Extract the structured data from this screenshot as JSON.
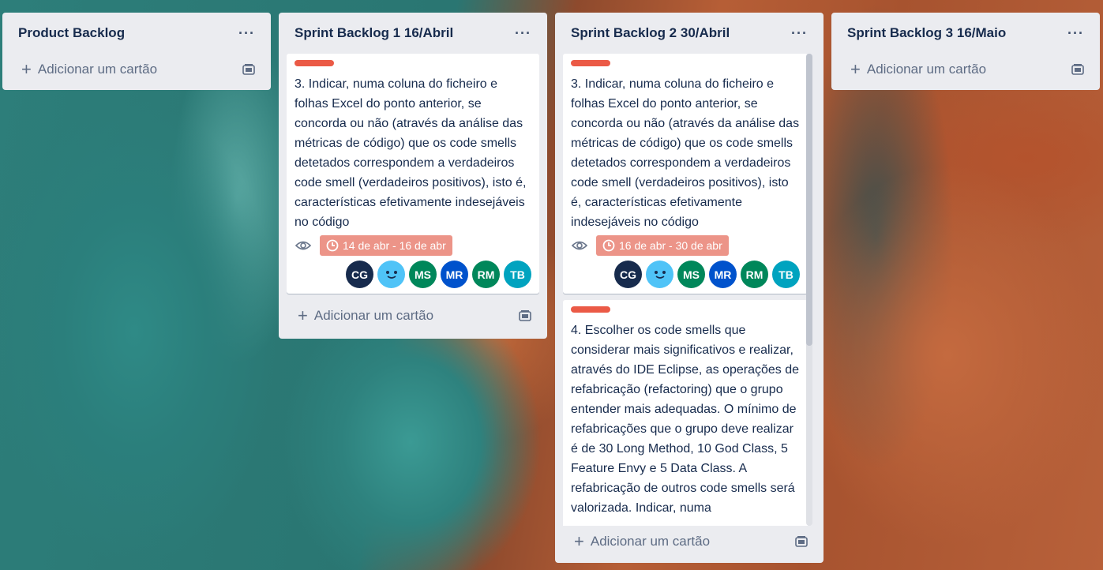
{
  "lists": [
    {
      "title": "Product Backlog",
      "add_label": "Adicionar um cartão"
    },
    {
      "title": "Sprint Backlog 1 16/Abril",
      "add_label": "Adicionar um cartão",
      "cards": [
        {
          "label_color": "#eb5a46",
          "text": "3. Indicar, numa coluna do ficheiro e folhas Excel do ponto anterior, se concorda ou não (através da análise das métricas de código) que os code smells detetados correspondem a verdadeiros code smell (verdadeiros positivos), isto é, características efetivamente indesejáveis no código",
          "due": "14 de abr - 16 de abr",
          "members": [
            "CG",
            "",
            "MS",
            "MR",
            "RM",
            "TB"
          ]
        }
      ]
    },
    {
      "title": "Sprint Backlog 2 30/Abril",
      "add_label": "Adicionar um cartão",
      "cards": [
        {
          "label_color": "#eb5a46",
          "text": "3. Indicar, numa coluna do ficheiro e folhas Excel do ponto anterior, se concorda ou não (através da análise das métricas de código) que os code smells detetados correspondem a verdadeiros code smell (verdadeiros positivos), isto é, características efetivamente indesejáveis no código",
          "due": "16 de abr - 30 de abr",
          "members": [
            "CG",
            "",
            "MS",
            "MR",
            "RM",
            "TB"
          ]
        },
        {
          "label_color": "#eb5a46",
          "text": "4. Escolher os code smells que considerar mais significativos e realizar, através do IDE Eclipse, as operações de refabricação (refactoring) que o grupo entender mais adequadas. O mínimo de refabricações que o grupo deve realizar é de 30 Long Method, 10 God Class, 5 Feature Envy e 5 Data Class. A refabricação de outros code smells será valorizada. Indicar, numa"
        }
      ]
    },
    {
      "title": "Sprint Backlog 3 16/Maio",
      "add_label": "Adicionar um cartão"
    }
  ],
  "icons": {
    "menu": "more-dots-icon",
    "add": "plus-icon",
    "template": "card-template-icon",
    "watch": "eye-icon",
    "clock": "clock-icon"
  },
  "avatar_colors": {
    "CG": "#172b4d",
    "face": "#4fc3f7",
    "MS": "#00875a",
    "MR": "#0052cc",
    "RM": "#00875a",
    "TB": "#00a3bf"
  }
}
